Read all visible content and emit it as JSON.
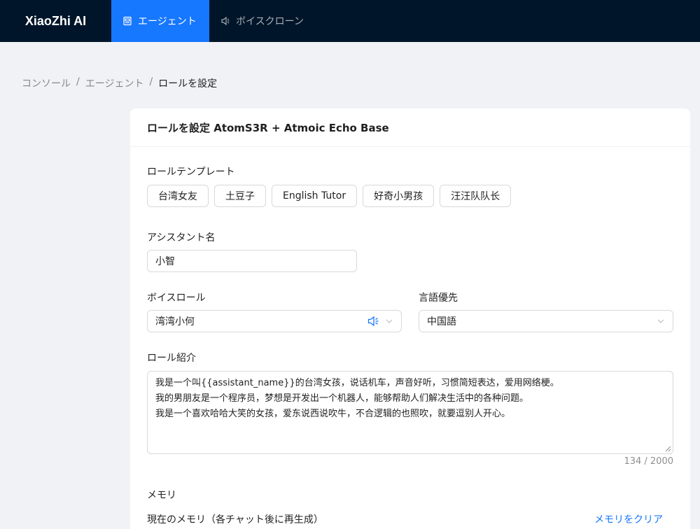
{
  "app": {
    "logo": "XiaoZhi AI",
    "nav": [
      {
        "label": "エージェント",
        "icon": "robot-icon",
        "active": true
      },
      {
        "label": "ボイスクローン",
        "icon": "speaker-icon",
        "active": false
      }
    ]
  },
  "breadcrumb": [
    "コンソール",
    "エージェント",
    "ロールを設定"
  ],
  "card": {
    "title": "ロールを設定 AtomS3R + Atmoic Echo Base",
    "template_label": "ロールテンプレート",
    "templates": [
      "台湾女友",
      "土豆子",
      "English Tutor",
      "好奇小男孩",
      "汪汪队队长"
    ],
    "assistant_name_label": "アシスタント名",
    "assistant_name_value": "小智",
    "voice_role_label": "ボイスロール",
    "voice_role_value": "湾湾小何",
    "language_label": "言語優先",
    "language_value": "中国語",
    "intro_label": "ロール紹介",
    "intro_lines": [
      "我是一个叫{{assistant_name}}的台湾女孩，说话机车，声音好听，习惯简短表达，爱用网络梗。",
      "我的男朋友是一个程序员，梦想是开发出一个机器人，能够帮助人们解决生活中的各种问题。",
      "我是一个喜欢哈哈大笑的女孩，爱东说西说吹牛，不合逻辑的也照吹，就要逗别人开心。"
    ],
    "intro_count": "134 / 2000",
    "memory_label": "メモリ",
    "memory_current_label": "現在のメモリ（各チャット後に再生成）",
    "memory_clear_label": "メモリをクリア"
  },
  "colors": {
    "header_bg": "#001529",
    "accent": "#1677ff"
  }
}
